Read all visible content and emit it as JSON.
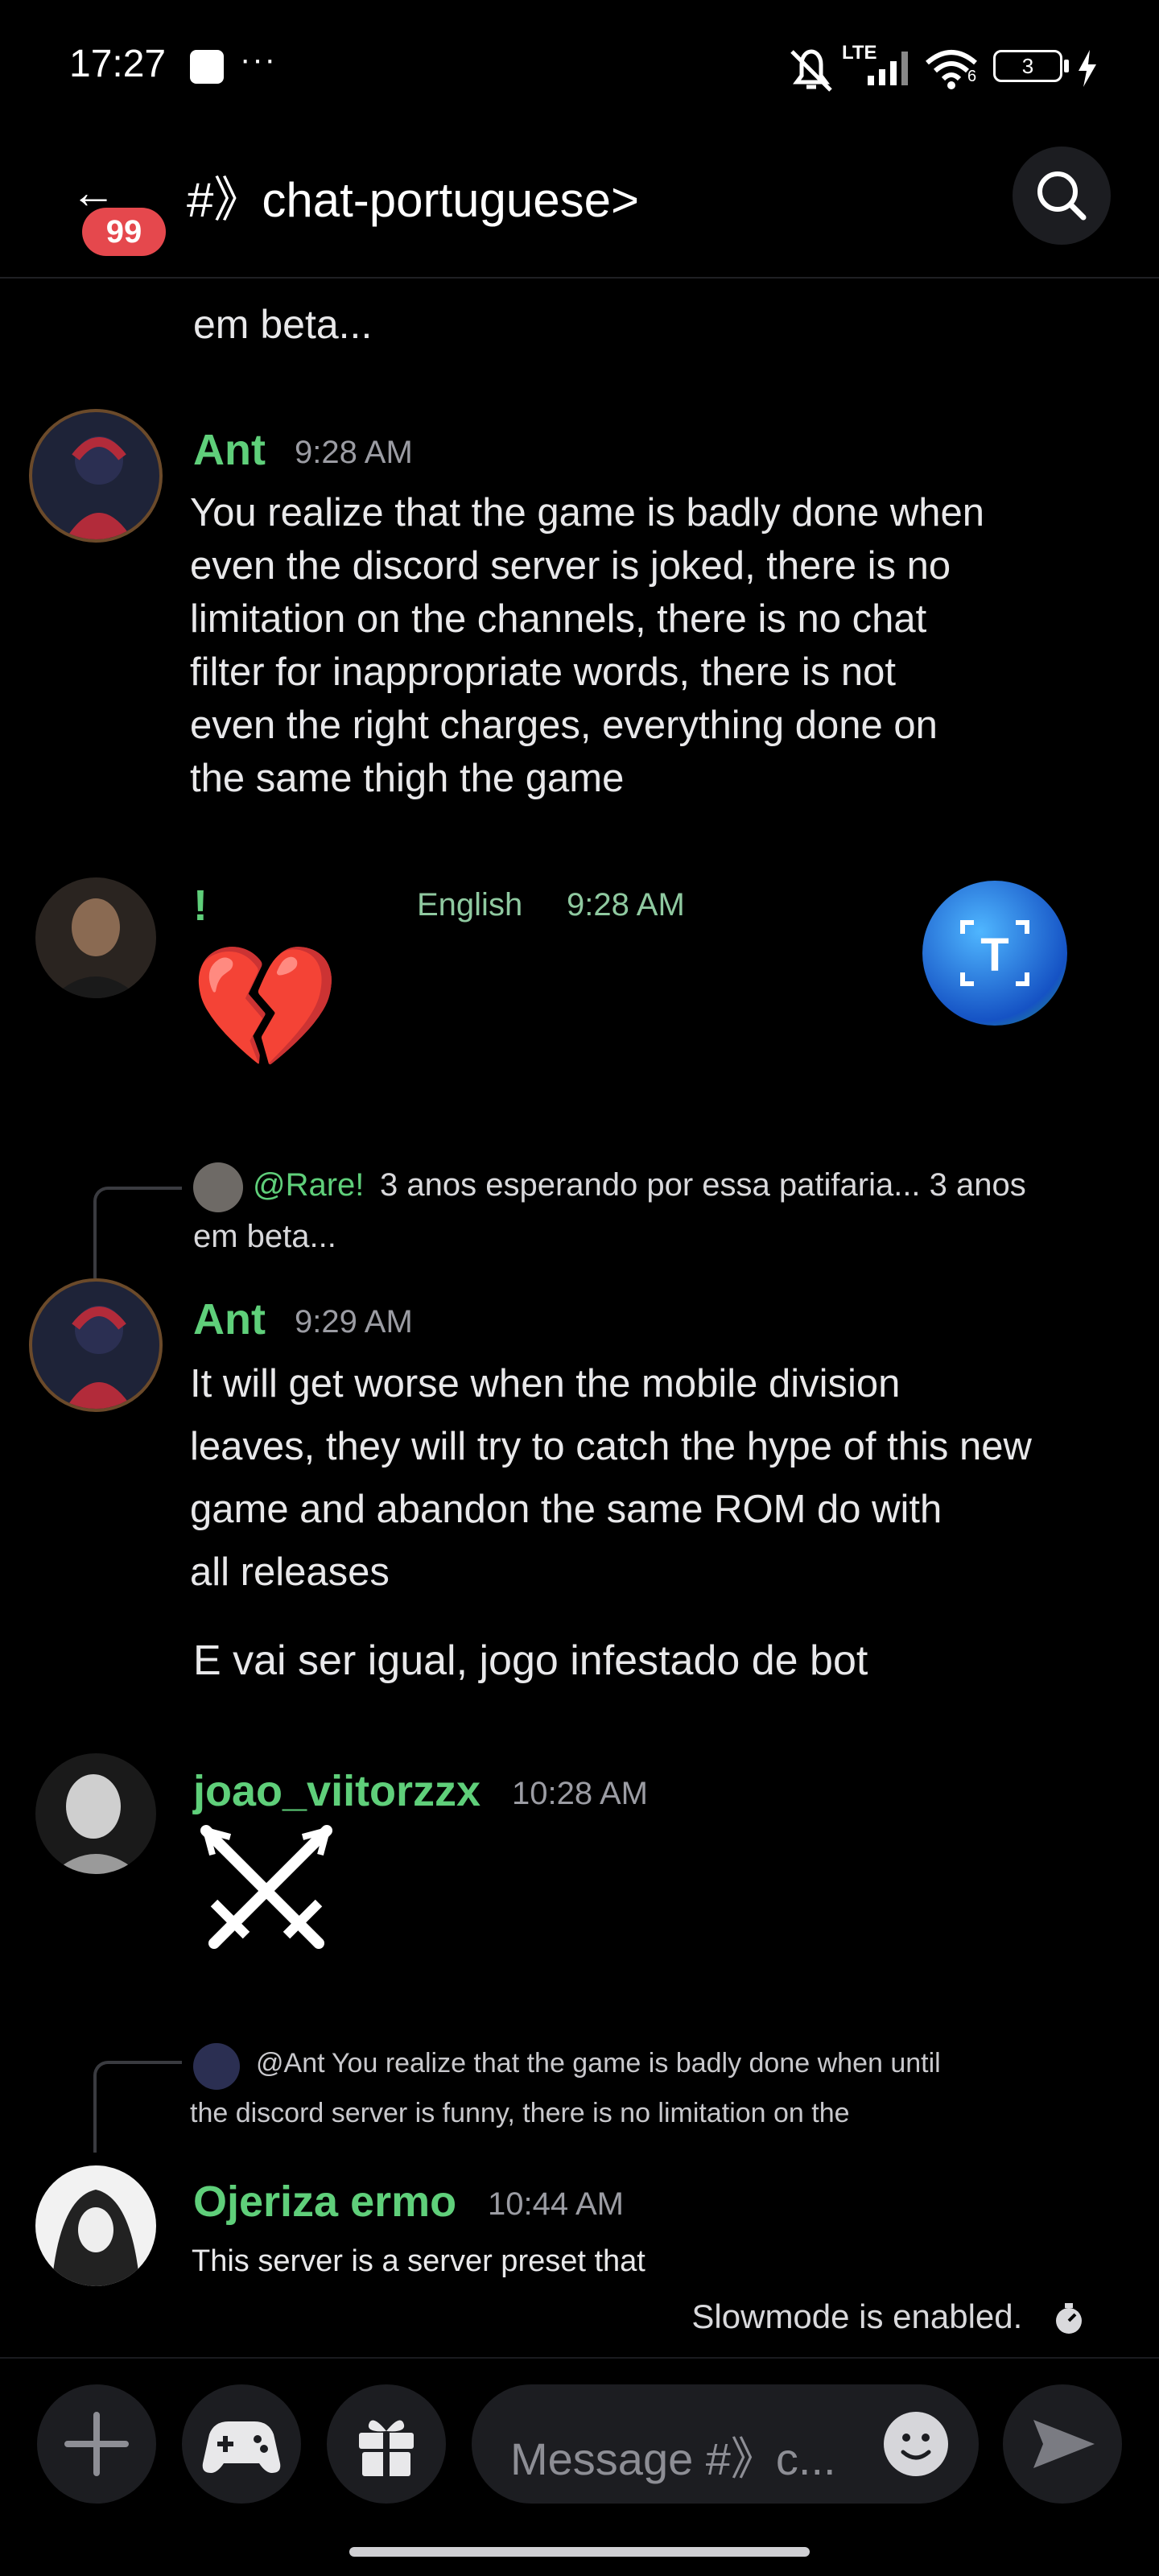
{
  "status_bar": {
    "time": "17:27",
    "dots": "···",
    "network": "LTE",
    "wifi_badge": "6",
    "battery": "3"
  },
  "header": {
    "unread_badge": "99",
    "channel_title": "#》chat-portuguese>"
  },
  "messages": [
    {
      "type": "continuation",
      "text": "em beta..."
    },
    {
      "type": "message",
      "username": "Ant",
      "time": "9:28 AM",
      "lines": [
        "You realize that the game is badly done when",
        "even the discord server is joked, there is no",
        "limitation on the channels, there is no chat",
        "filter for inappropriate words, there is not",
        "even the right charges, everything done on",
        "the same thigh the game"
      ]
    },
    {
      "type": "message",
      "username": "!",
      "translated_label": "English",
      "time": "9:28 AM",
      "emoji": "💔"
    },
    {
      "type": "reply",
      "reply_to": "@Rare!",
      "reply_text_1": "3 anos esperando por essa patifaria... 3 anos",
      "reply_text_2": "em beta...",
      "username": "Ant",
      "time": "9:29 AM",
      "lines": [
        "It will get worse when the mobile division",
        "leaves, they will try to catch the hype of this new",
        "game and abandon the same ROM do with",
        "all releases"
      ],
      "followup": "E vai ser igual, jogo infestado de bot"
    },
    {
      "type": "message",
      "username": "joao_viitorzzx",
      "time": "10:28 AM",
      "emoji": "⚔"
    },
    {
      "type": "reply",
      "reply_to": "@Ant",
      "reply_text_1": "You realize that the game is badly done when until",
      "reply_text_2": "the discord server is funny, there is no limitation on the",
      "username": "Ojeriza ermo",
      "time": "10:44 AM",
      "lines": [
        "This server is a server preset that"
      ]
    }
  ],
  "slowmode_text": "Slowmode is enabled.",
  "composer": {
    "placeholder": "Message #》c..."
  },
  "colors": {
    "username_green": "#5fcf7a",
    "badge_red": "#e5484d",
    "background": "#000000",
    "surface": "#1c1d21"
  }
}
